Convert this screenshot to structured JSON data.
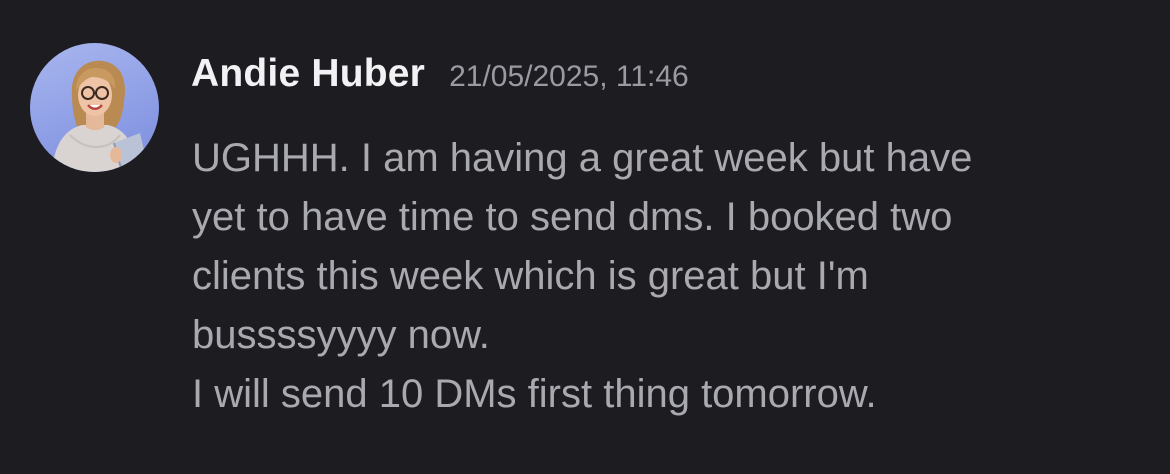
{
  "message": {
    "author": "Andie Huber",
    "timestamp": "21/05/2025, 11:46",
    "avatar_icon": "user-avatar-photo",
    "lines": [
      "UGHHH. I am having a great week but have",
      "yet to have time to send dms. I booked two",
      "clients this week which is great but I'm",
      "bussssyyyy now.",
      "I will send 10 DMs first thing tomorrow."
    ]
  },
  "colors": {
    "background": "#1c1c21",
    "author": "#f2f2f4",
    "timestamp": "#9a9aa2",
    "text": "#a9a9b0"
  }
}
